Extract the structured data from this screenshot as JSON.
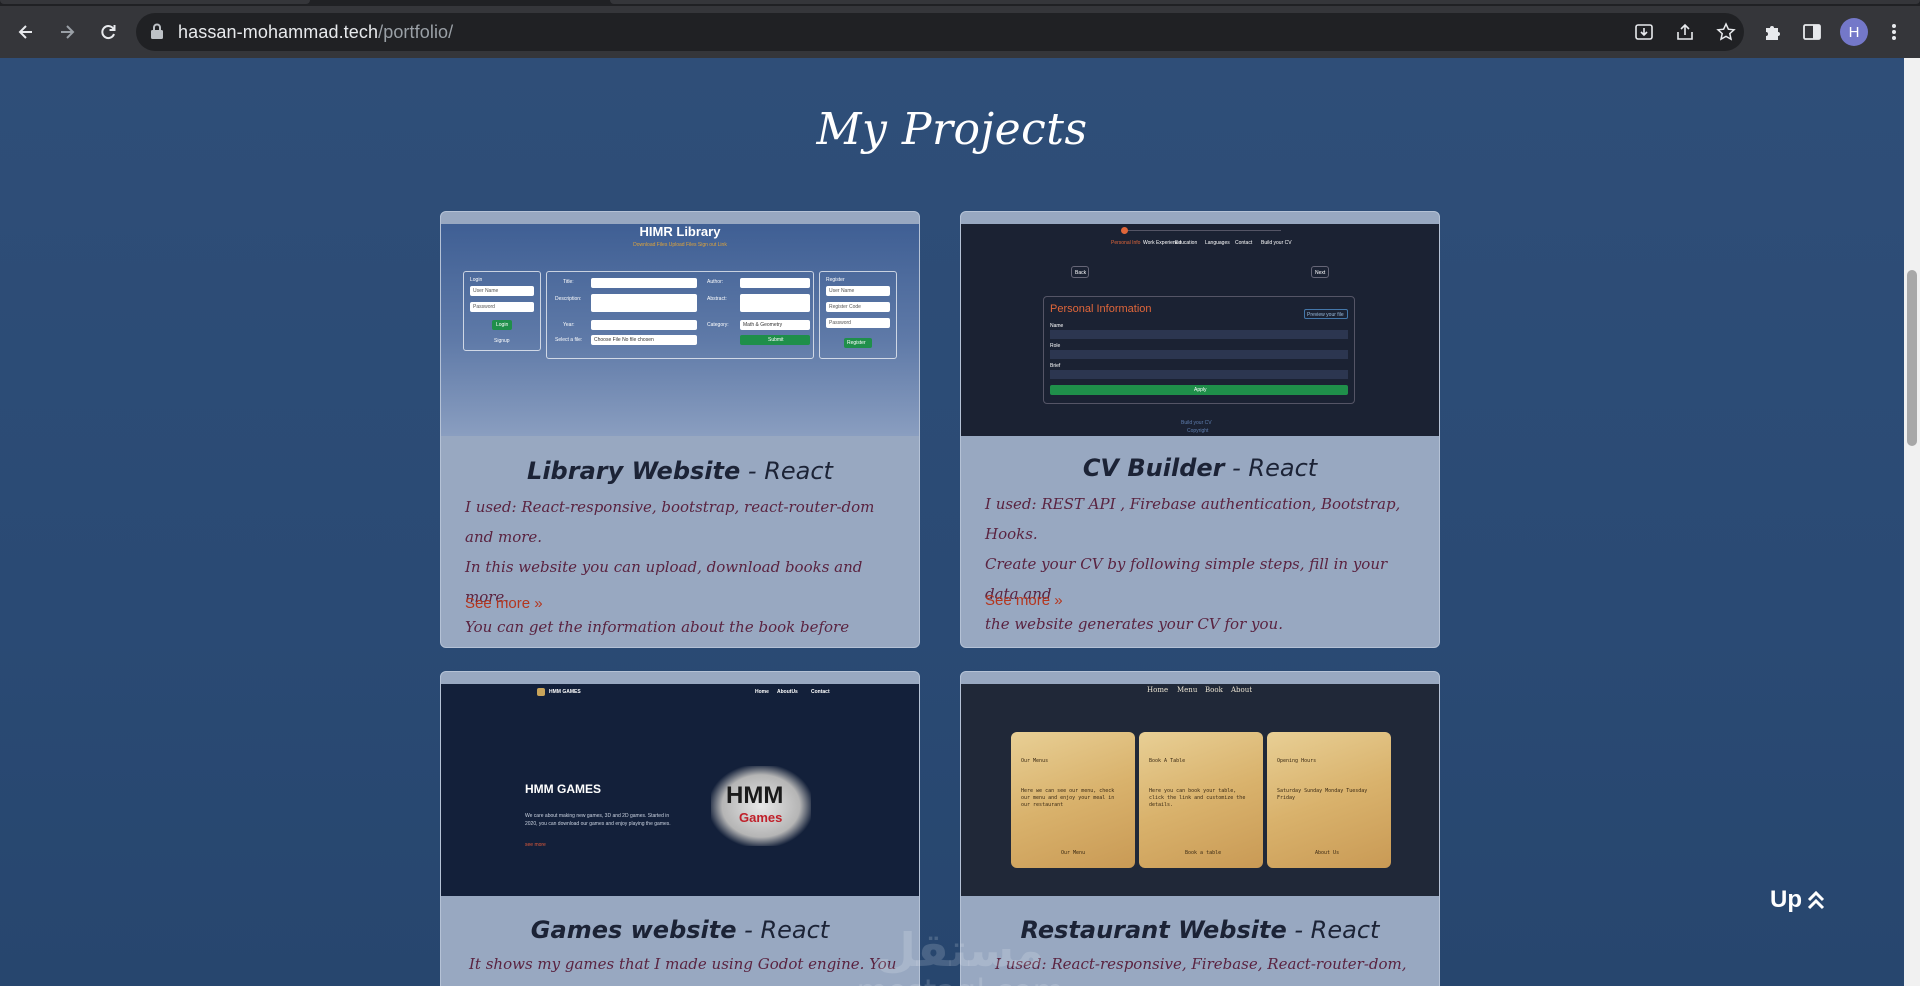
{
  "browser": {
    "url_host": "hassan-mohammad.tech",
    "url_path": "/portfolio/",
    "profile_initial": "H"
  },
  "page": {
    "section_title": "My Projects",
    "up_button_label": "Up",
    "watermark_arabic": "مستقل",
    "watermark_latin": "mostaql.com"
  },
  "projects": [
    {
      "name": "Library Website",
      "tech": "- React",
      "lines": [
        "I used: React-responsive, bootstrap, react-router-dom and more.",
        "In this website you can upload, download books and more.",
        "You can get the information about the book before download"
      ],
      "see_more": "See more »",
      "preview": {
        "title": "HIMR Library",
        "links": "Download Files   Upload Files   Sign out Link",
        "login_label": "Login",
        "login_user": "User Name",
        "login_pass": "Password",
        "login_btn": "Login",
        "signup_link": "Signup",
        "title_label": "Title:",
        "description_label": "Description:",
        "year_label": "Year:",
        "file_label": "Select a file:",
        "file_value": "Choose File   No file chosen",
        "author_label": "Author:",
        "abstract_label": "Abstract:",
        "category_label": "Category:",
        "category_value": "Math & Geometry",
        "submit_btn": "Submit",
        "register_label": "Register",
        "reg_user": "User Name",
        "reg_code": "Register Code",
        "reg_pass": "Password",
        "register_btn": "Register"
      }
    },
    {
      "name": "CV Builder",
      "tech": "- React",
      "lines": [
        "I used: REST API , Firebase authentication, Bootstrap, Hooks.",
        "Create your CV by following simple steps, fill in your data and",
        "the website generates your CV for you."
      ],
      "see_more": "See more »",
      "preview": {
        "steps": [
          "Personal Info",
          "Work Experience",
          "Education",
          "Languages",
          "Contact",
          "Build your CV"
        ],
        "back_btn": "Back",
        "next_btn": "Next",
        "form_title": "Personal Information",
        "preview_link": "Preview your file",
        "name_label": "Name",
        "role_label": "Role",
        "brief_label": "Brief",
        "apply_btn": "Apply",
        "footer_link": "Build your CV",
        "footer_copy": "Copyright"
      }
    },
    {
      "name": "Games website",
      "tech": "- React",
      "lines": [
        "It shows my games that I made using Godot engine. You can see"
      ],
      "see_more": "",
      "preview": {
        "brand": "HMM GAMES",
        "nav": [
          "Home",
          "AboutUs",
          "Contact"
        ],
        "hero_title": "HMM GAMES",
        "hero_text": "We care about making new games, 3D and 2D games. Started in 2020, you can download our games and enjoy playing the games.",
        "hero_link": "see more",
        "logo_top": "HMM",
        "logo_bottom": "Games"
      }
    },
    {
      "name": "Restaurant Website",
      "tech": "- React",
      "lines": [
        "I used: React-responsive, Firebase, React-router-dom, Hooks."
      ],
      "see_more": "",
      "preview": {
        "nav": [
          "Home",
          "Menu",
          "Book",
          "About"
        ],
        "cards": [
          {
            "title": "Our Menus",
            "body": "Here we can see our menu, check our menu and enjoy your meal in our restaurant",
            "btn": "Our Menu"
          },
          {
            "title": "Book A Table",
            "body": "Here you can book your table, click the link and customize the details.",
            "btn": "Book a table"
          },
          {
            "title": "Opening Hours",
            "body": "Saturday  Sunday  Monday  Tuesday  Friday",
            "btn": "About Us"
          }
        ]
      }
    }
  ],
  "colors": {
    "page_bg": "#2f4e78",
    "card_bg": "#98a8c1",
    "desc_text": "#5a2340",
    "link_text": "#b4361e",
    "green_button": "#1f8f4a"
  }
}
